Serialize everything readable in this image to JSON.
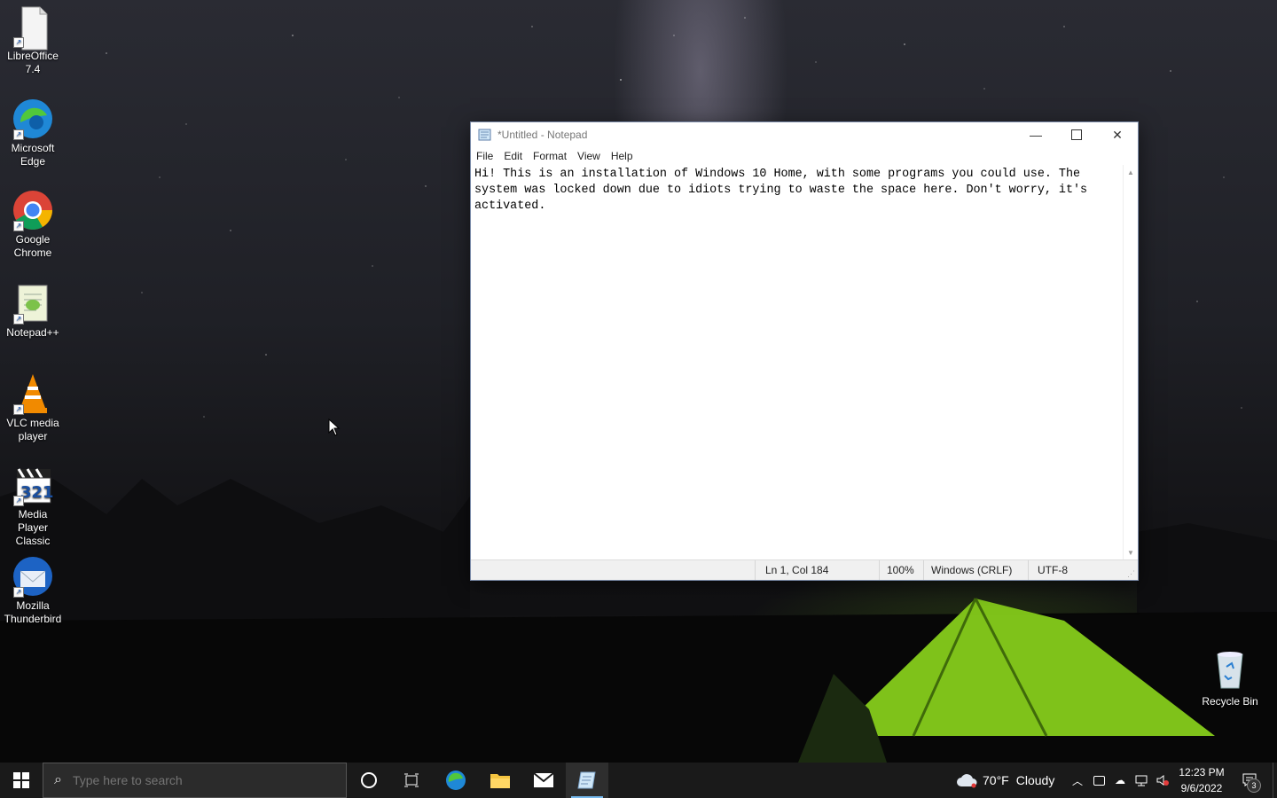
{
  "desktop": {
    "icons": [
      {
        "label": "LibreOffice 7.4"
      },
      {
        "label": "Microsoft Edge"
      },
      {
        "label": "Google Chrome"
      },
      {
        "label": "Notepad++"
      },
      {
        "label": "VLC media player"
      },
      {
        "label": "Media Player Classic"
      },
      {
        "label": "Mozilla Thunderbird"
      }
    ],
    "recycle_bin": "Recycle Bin"
  },
  "notepad": {
    "title": "*Untitled - Notepad",
    "menu": [
      "File",
      "Edit",
      "Format",
      "View",
      "Help"
    ],
    "content": "Hi! This is an installation of Windows 10 Home, with some programs you could use. The\nsystem was locked down due to idiots trying to waste the space here. Don't worry, it's\nactivated.",
    "status": {
      "position": "Ln 1, Col 184",
      "zoom": "100%",
      "line_endings": "Windows (CRLF)",
      "encoding": "UTF-8"
    }
  },
  "taskbar": {
    "search_placeholder": "Type here to search",
    "weather": {
      "temp": "70°F",
      "condition": "Cloudy"
    },
    "clock": {
      "time": "12:23 PM",
      "date": "9/6/2022"
    },
    "notification_count": "3",
    "colors": {
      "taskbar_bg": "#1a1a1a",
      "active_indicator": "#76b9ed"
    }
  }
}
